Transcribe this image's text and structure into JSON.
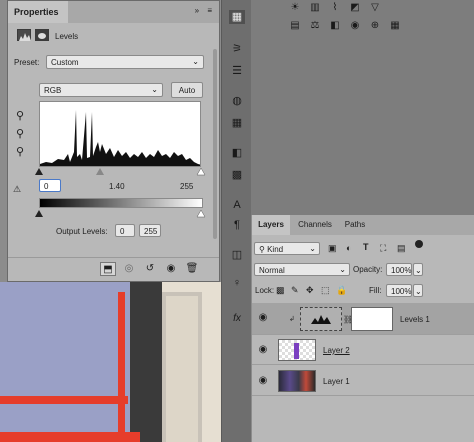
{
  "properties": {
    "tab_title": "Properties",
    "adjustment_name": "Levels",
    "preset_label": "Preset:",
    "preset_value": "Custom",
    "channel_value": "RGB",
    "auto_label": "Auto",
    "input_black": "0",
    "input_gamma": "1.40",
    "input_white": "255",
    "output_label": "Output Levels:",
    "output_black": "0",
    "output_white": "255"
  },
  "layers": {
    "tabs": [
      "Layers",
      "Channels",
      "Paths"
    ],
    "filter_value": "Kind",
    "blend_mode": "Normal",
    "opacity_label": "Opacity:",
    "opacity_value": "100%",
    "lock_label": "Lock:",
    "fill_label": "Fill:",
    "fill_value": "100%",
    "items": [
      {
        "name": "Levels 1"
      },
      {
        "name": "Layer 2"
      },
      {
        "name": "Layer 1"
      }
    ]
  },
  "colors": {
    "accent_red": "#e63d2b",
    "panel_bg": "#b8b8b8",
    "selected_row": "#a3a3a3"
  }
}
